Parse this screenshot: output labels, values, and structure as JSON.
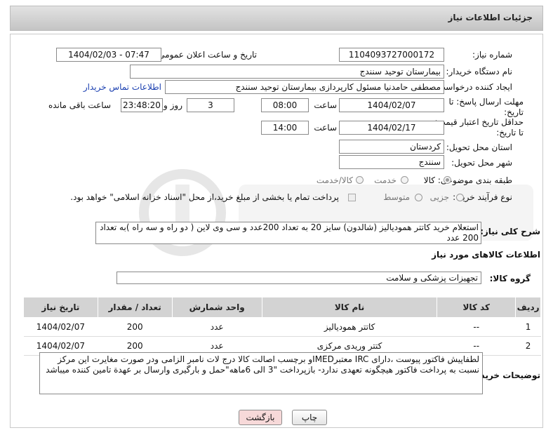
{
  "header": {
    "title": "جزئیات اطلاعات نیاز"
  },
  "fields": {
    "need_number_label": "شماره نیاز:",
    "need_number": "1104093727000172",
    "announce_label": "تاریخ و ساعت اعلان عمومی:",
    "announce_value": "1404/02/03 - 07:47",
    "buyer_label": "نام دستگاه خریدار:",
    "buyer_value": "بیمارستان توحید سنندج",
    "creator_label": "ایجاد کننده درخواست:",
    "creator_value": "مصطفی حامدنیا مسئول کارپردازی بیمارستان توحید سنندج",
    "contact_link": "اطلاعات تماس خریدار",
    "deadline_label": "مهلت ارسال پاسخ: تا تاریخ:",
    "deadline_date": "1404/02/07",
    "time_label": "ساعت",
    "deadline_time": "08:00",
    "days_value": "3",
    "days_label": "روز و",
    "remaining_value": "23:48:20",
    "remaining_label": "ساعت باقی مانده",
    "validity_label": "حداقل تاریخ اعتبار قیمت: تا تاریخ:",
    "validity_date": "1404/02/17",
    "validity_time": "14:00",
    "province_label": "استان محل تحویل:",
    "province_value": "کردستان",
    "city_label": "شهر محل تحویل:",
    "city_value": "سنندج",
    "category_label": "طبقه بندی موضوعی:",
    "category_options": [
      "کالا",
      "خدمت",
      "کالا/خدمت"
    ],
    "category_selected": "کالا",
    "process_label": "نوع فرآیند خرید :",
    "process_options": [
      "جزیی",
      "متوسط"
    ],
    "payment_note": "پرداخت تمام یا بخشی از مبلغ خرید،از محل \"اسناد خزانه اسلامی\" خواهد بود."
  },
  "description": {
    "label": "شرح کلی نیاز:",
    "text": "استعلام خرید کاتتر همودیالیز (شالدون) سایز 20 به تعداد  200عدد و سی وی لاین ( دو راه و سه راه )به تعداد 200 عدد"
  },
  "goods_section": {
    "title": "اطلاعات کالاهای مورد نیاز",
    "group_label": "گروه کالا:",
    "group_value": "تجهیزات پزشکی و سلامت"
  },
  "table": {
    "headers": [
      "ردیف",
      "کد کالا",
      "نام کالا",
      "واحد شمارش",
      "تعداد / مقدار",
      "تاریخ نیاز"
    ],
    "rows": [
      [
        "1",
        "--",
        "کاتتر همودیالیز",
        "عدد",
        "200",
        "1404/02/07"
      ],
      [
        "2",
        "--",
        "کتتر وریدی مرکزی",
        "عدد",
        "200",
        "1404/02/07"
      ]
    ]
  },
  "buyer_notes": {
    "label": "توضیحات خریدار:",
    "text": "لطفاپیش فاکتور پیوست ،دارای IRC معتبرIMEDو برچسب اصالت کالا درج لات نامبر الزامی ودر صورت مغایرت این مرکز نسبت به پرداخت فاکتور هیچگونه تعهدی ندارد- بازپرداخت \"3 الی 6ماهه\"حمل و بارگیری وارسال بر عهدة تامین کننده میباشد"
  },
  "buttons": {
    "print": "چاپ",
    "back": "بازگشت"
  },
  "colors": {
    "accent": "#1a3fb0",
    "header_bg": "#d0d0d0",
    "back_button": "#f7d9d9"
  }
}
